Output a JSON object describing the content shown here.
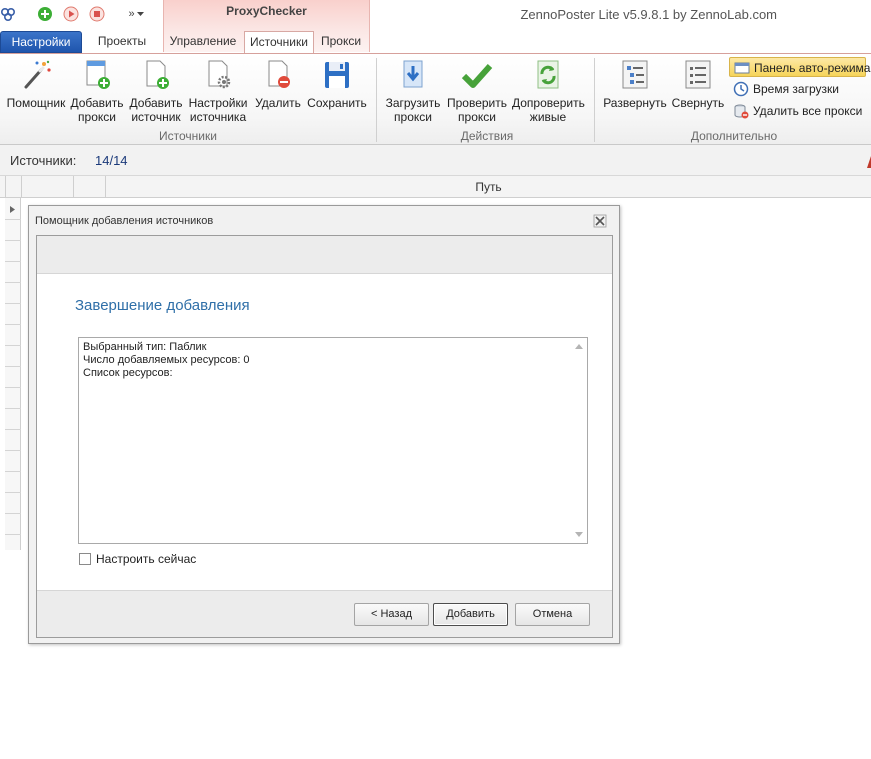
{
  "window": {
    "app_title": "ZennoPoster Lite v5.9.8.1 by ZennoLab.com",
    "context_group": "ProxyChecker"
  },
  "quick_access": {
    "overflow": "»"
  },
  "tabs": [
    {
      "label": "Настройки"
    },
    {
      "label": "Проекты"
    },
    {
      "label": "Управление"
    },
    {
      "label": "Источники"
    },
    {
      "label": "Прокси"
    }
  ],
  "ribbon": {
    "sources_group": {
      "label": "Источники",
      "buttons": [
        {
          "label": "Помощник"
        },
        {
          "label": "Добавить\nпрокси"
        },
        {
          "label": "Добавить\nисточник"
        },
        {
          "label": "Настройки\nисточника"
        },
        {
          "label": "Удалить"
        },
        {
          "label": "Сохранить"
        }
      ]
    },
    "actions_group": {
      "label": "Действия",
      "buttons": [
        {
          "label": "Загрузить\nпрокси"
        },
        {
          "label": "Проверить\nпрокси"
        },
        {
          "label": "Допроверить\nживые"
        }
      ]
    },
    "extra_group": {
      "label": "Дополнительно",
      "buttons": [
        {
          "label": "Развернуть"
        },
        {
          "label": "Свернуть"
        }
      ],
      "small_buttons": [
        {
          "label": "Панель авто-режима"
        },
        {
          "label": "Время загрузки"
        },
        {
          "label": "Удалить все прокси"
        }
      ]
    }
  },
  "sources_bar": {
    "label": "Источники:",
    "count": "14/14"
  },
  "grid": {
    "columns": [
      "Путь"
    ]
  },
  "dialog": {
    "title": "Помощник добавления источников",
    "heading": "Завершение добавления",
    "lines": [
      "Выбранный тип: Паблик",
      "Число добавляемых ресурсов: 0",
      "Список ресурсов:"
    ],
    "checkbox_label": "Настроить сейчас",
    "checkbox_checked": false,
    "buttons": {
      "back": "< Назад",
      "add": "Добавить",
      "cancel": "Отмена"
    }
  },
  "colors": {
    "accent_blue": "#1f55ad",
    "context_red": "#e8b5b0",
    "heading_blue": "#2f6fa8",
    "highlight_yellow": "#f6d45a"
  }
}
